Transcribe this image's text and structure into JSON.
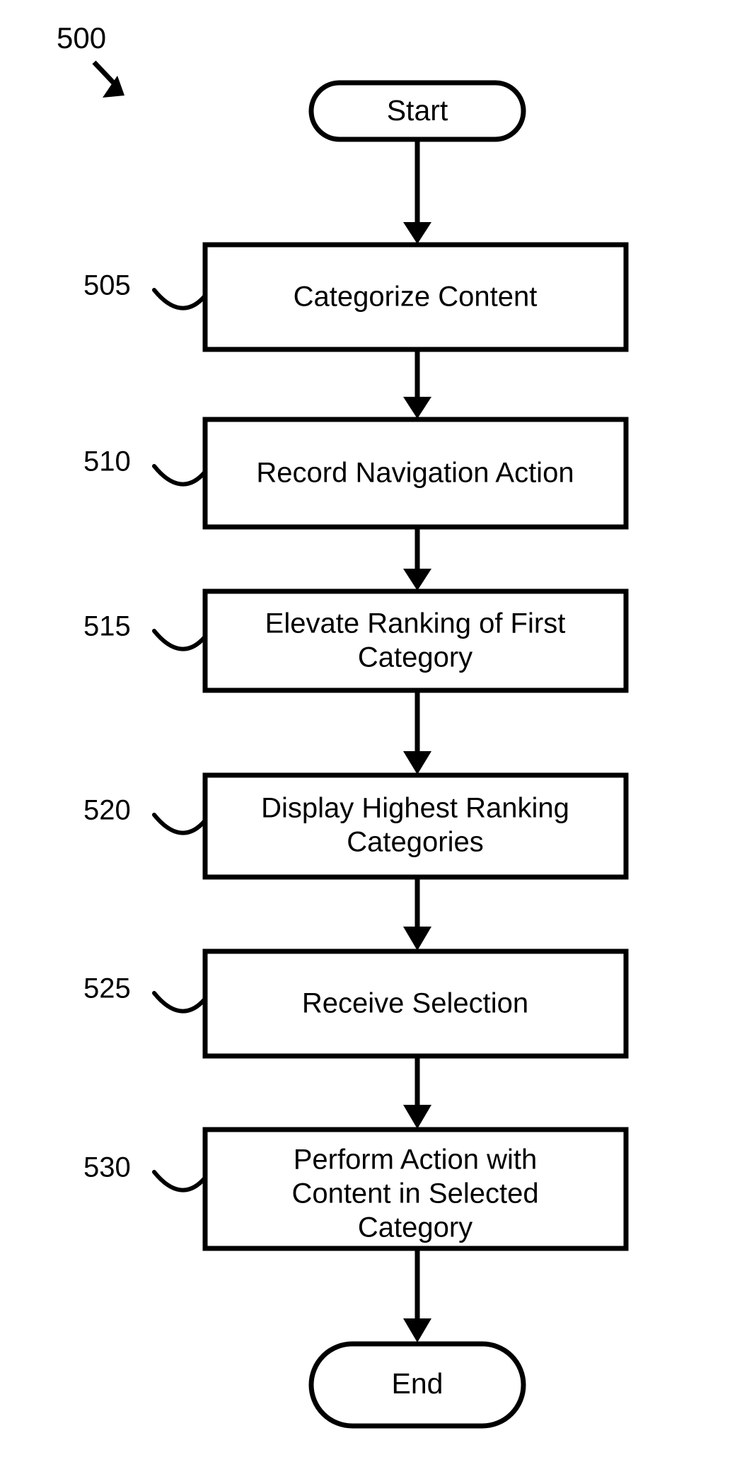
{
  "figure": {
    "number": "500",
    "kind": "flowchart"
  },
  "terminals": {
    "start": {
      "label": "Start"
    },
    "end": {
      "label": "End"
    }
  },
  "steps": [
    {
      "ref": "505",
      "lines": [
        "Categorize Content"
      ]
    },
    {
      "ref": "510",
      "lines": [
        "Record Navigation Action"
      ]
    },
    {
      "ref": "515",
      "lines": [
        "Elevate Ranking of First",
        "Category"
      ]
    },
    {
      "ref": "520",
      "lines": [
        "Display Highest Ranking",
        "Categories"
      ]
    },
    {
      "ref": "525",
      "lines": [
        "Receive Selection"
      ]
    },
    {
      "ref": "530",
      "lines": [
        "Perform Action with",
        "Content in Selected",
        "Category"
      ]
    }
  ],
  "colors": {
    "stroke": "#000000",
    "fill": "#ffffff",
    "background": "#ffffff"
  }
}
